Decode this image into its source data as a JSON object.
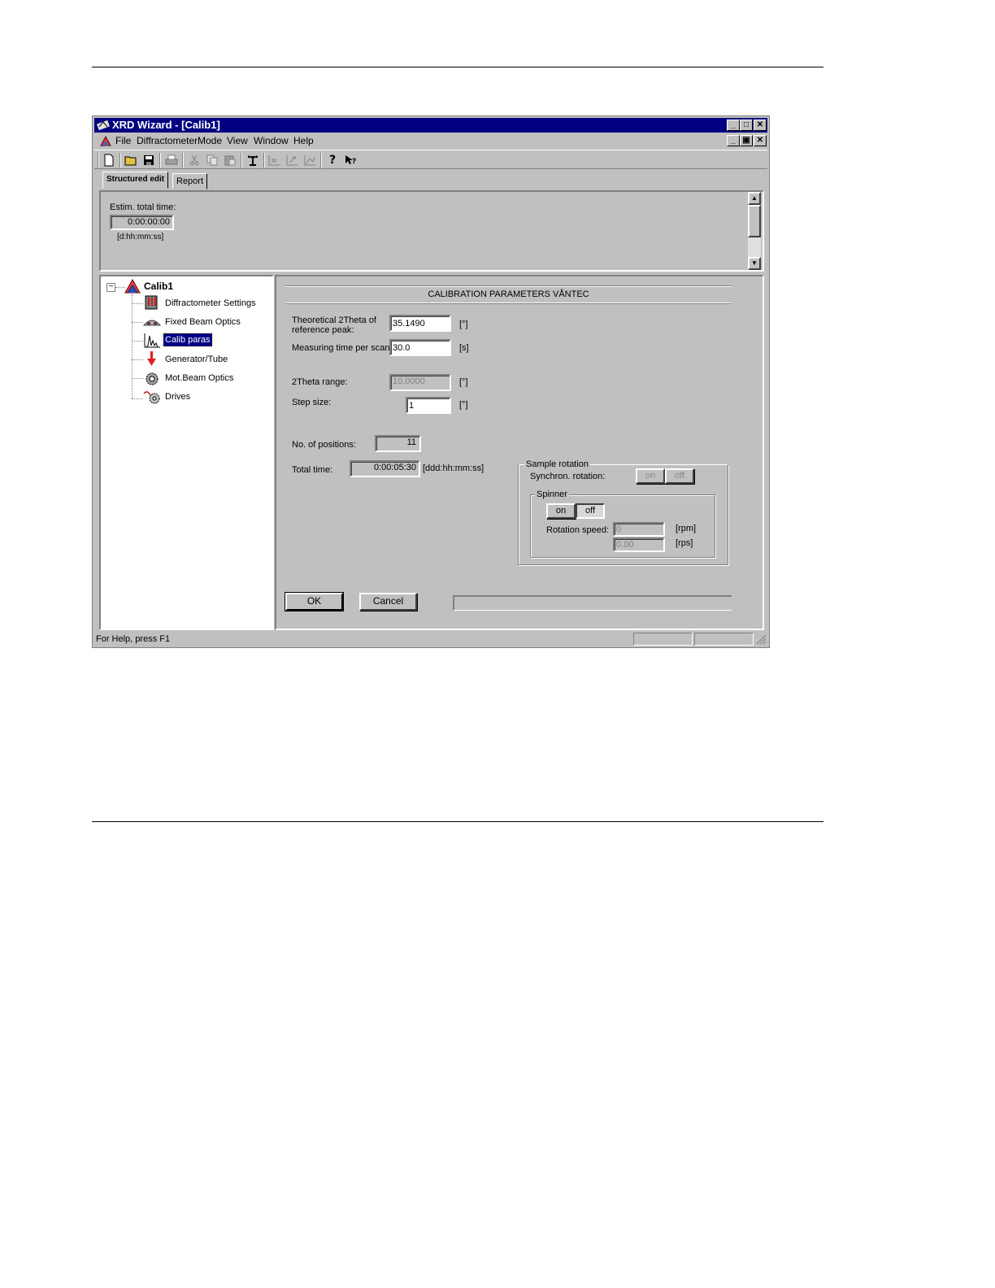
{
  "window": {
    "title": "XRD Wizard - [Calib1]"
  },
  "menu": {
    "file": "File",
    "diffractometer": "Diffractometer",
    "mode": "Mode",
    "view": "View",
    "window": "Window",
    "help": "Help"
  },
  "tabs": {
    "structured_edit": "Structured edit",
    "report": "Report"
  },
  "summary": {
    "estim_label": "Estim. total time:",
    "estim_value": "0:00:00:00",
    "estim_unit": "[d:hh:mm:ss]"
  },
  "tree": {
    "root": "Calib1",
    "items": [
      {
        "label": "Diffractometer Settings",
        "icon": "diffractometer-icon"
      },
      {
        "label": "Fixed Beam Optics",
        "icon": "beam-optics-icon"
      },
      {
        "label": "Calib paras",
        "icon": "peaks-chart-icon",
        "selected": true
      },
      {
        "label": "Generator/Tube",
        "icon": "generator-arrow-icon"
      },
      {
        "label": "Mot.Beam Optics",
        "icon": "motor-gear-icon"
      },
      {
        "label": "Drives",
        "icon": "drives-gear-icon"
      }
    ]
  },
  "form": {
    "header": "CALIBRATION PARAMETERS VÅNTEC",
    "theta_label_1": "Theoretical 2Theta of",
    "theta_label_2": "reference peak:",
    "theta_value": "35.1490",
    "theta_unit": "[°]",
    "time_label": "Measuring time per scan:",
    "time_value": "30.0",
    "time_unit": "[s]",
    "range_label": "2Theta range:",
    "range_value": "10.0000",
    "range_unit": "[°]",
    "step_label": "Step size:",
    "step_value": "1",
    "step_unit": "[°]",
    "positions_label": "No. of positions:",
    "positions_value": "11",
    "total_label": "Total time:",
    "total_value": "0:00:05:30",
    "total_unit": "[ddd:hh:mm:ss]",
    "sample_rotation": {
      "title": "Sample rotation",
      "synchron_label": "Synchron. rotation:",
      "on": "on",
      "off": "off"
    },
    "spinner": {
      "title": "Spinner",
      "on": "on",
      "off": "off",
      "speed_label": "Rotation speed:",
      "rpm_value": "0",
      "rpm_unit": "[rpm]",
      "rps_value": "0.00",
      "rps_unit": "[rps]"
    },
    "ok": "OK",
    "cancel": "Cancel"
  },
  "status": {
    "text": "For Help, press F1"
  },
  "colors": {
    "titlebar": "#000080",
    "face": "#c0c0c0",
    "selection": "#000080"
  }
}
